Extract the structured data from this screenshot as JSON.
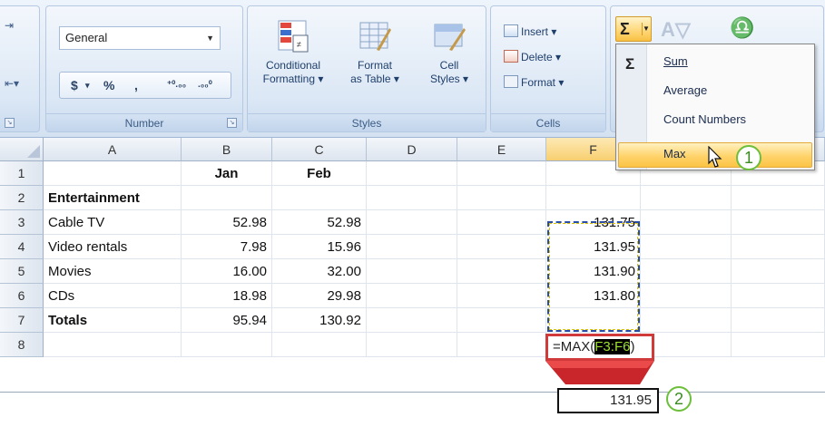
{
  "ribbon": {
    "number_group": {
      "label": "Number",
      "format_value": "General",
      "currency_symbol": "$",
      "percent_symbol": "%",
      "comma_symbol": ",",
      "inc_decimal": ".00 →.0",
      "dec_decimal": ".00"
    },
    "styles_group": {
      "label": "Styles",
      "conditional_formatting": [
        "Conditional",
        "Formatting ▾"
      ],
      "format_as_table": [
        "Format",
        "as Table ▾"
      ],
      "cell_styles": [
        "Cell",
        "Styles ▾"
      ]
    },
    "cells_group": {
      "label": "Cells",
      "insert": "Insert ▾",
      "delete": "Delete ▾",
      "format": "Format ▾"
    },
    "editing": {
      "sigma": "Σ",
      "dropdown": {
        "items": [
          "Sum",
          "Average",
          "Count Numbers",
          "Max"
        ],
        "selected": "Max"
      }
    }
  },
  "callouts": [
    "1",
    "2"
  ],
  "columns": [
    "A",
    "B",
    "C",
    "D",
    "E",
    "F"
  ],
  "rows": [
    {
      "num": "1",
      "a": "",
      "b": "Jan",
      "c": "Feb",
      "f": ""
    },
    {
      "num": "2",
      "a": "Entertainment",
      "b": "",
      "c": "",
      "f": ""
    },
    {
      "num": "3",
      "a": "Cable TV",
      "b": "52.98",
      "c": "52.98",
      "f": "131.75"
    },
    {
      "num": "4",
      "a": "Video rentals",
      "b": "7.98",
      "c": "15.96",
      "f": "131.95"
    },
    {
      "num": "5",
      "a": "Movies",
      "b": "16.00",
      "c": "32.00",
      "f": "131.90"
    },
    {
      "num": "6",
      "a": "CDs",
      "b": "18.98",
      "c": "29.98",
      "f": "131.80"
    },
    {
      "num": "7",
      "a": "Totals",
      "b": "95.94",
      "c": "130.92",
      "f": ""
    },
    {
      "num": "8",
      "a": "",
      "b": "",
      "c": "",
      "f": ""
    }
  ],
  "formula": {
    "prefix": "=MAX(",
    "range": "F3:F6",
    "suffix": ")"
  },
  "result": "131.95",
  "colors": {
    "accent_orange": "#ffd36a",
    "selection_blue": "#2a4ea8",
    "error_red": "#d03a3a",
    "callout_green": "#6cbf3a"
  }
}
